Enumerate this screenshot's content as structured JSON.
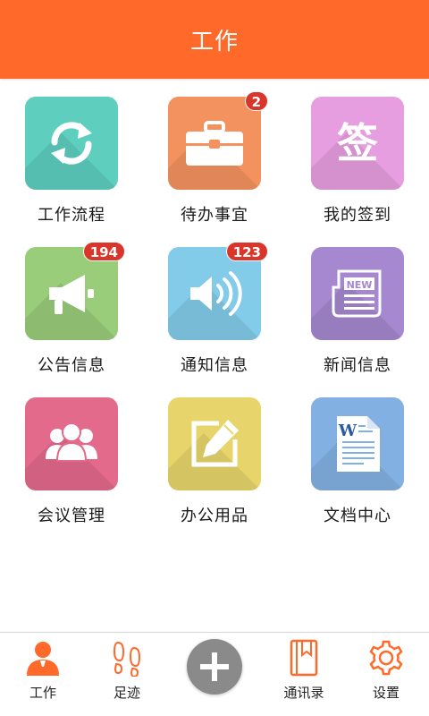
{
  "header": {
    "title": "工作"
  },
  "grid": {
    "items": [
      {
        "label": "工作流程",
        "color": "#5ecfbf",
        "icon": "refresh-icon",
        "badge": null
      },
      {
        "label": "待办事宜",
        "color": "#f4925f",
        "icon": "briefcase-icon",
        "badge": "2"
      },
      {
        "label": "我的签到",
        "color": "#e79ee0",
        "icon": "sign-in-icon",
        "badge": null
      },
      {
        "label": "公告信息",
        "color": "#99cd7a",
        "icon": "megaphone-icon",
        "badge": "194"
      },
      {
        "label": "通知信息",
        "color": "#82cbe9",
        "icon": "speaker-icon",
        "badge": "123"
      },
      {
        "label": "新闻信息",
        "color": "#a588cf",
        "icon": "newspaper-icon",
        "badge": null
      },
      {
        "label": "会议管理",
        "color": "#e46a8c",
        "icon": "meeting-people-icon",
        "badge": null
      },
      {
        "label": "办公用品",
        "color": "#e7d56b",
        "icon": "edit-icon",
        "badge": null
      },
      {
        "label": "文档中心",
        "color": "#83b0e2",
        "icon": "word-document-icon",
        "badge": null
      }
    ],
    "sign_glyph": "签",
    "news_glyph": "NEW",
    "doc_glyph": "W"
  },
  "tabbar": {
    "items": [
      {
        "label": "工作",
        "icon": "person-icon",
        "active": true
      },
      {
        "label": "足迹",
        "icon": "footprints-icon",
        "active": false
      },
      {
        "label": "",
        "icon": "plus-icon",
        "active": false
      },
      {
        "label": "通讯录",
        "icon": "address-book-icon",
        "active": false
      },
      {
        "label": "设置",
        "icon": "gear-icon",
        "active": false
      }
    ],
    "accent": "#ff6a2a"
  }
}
